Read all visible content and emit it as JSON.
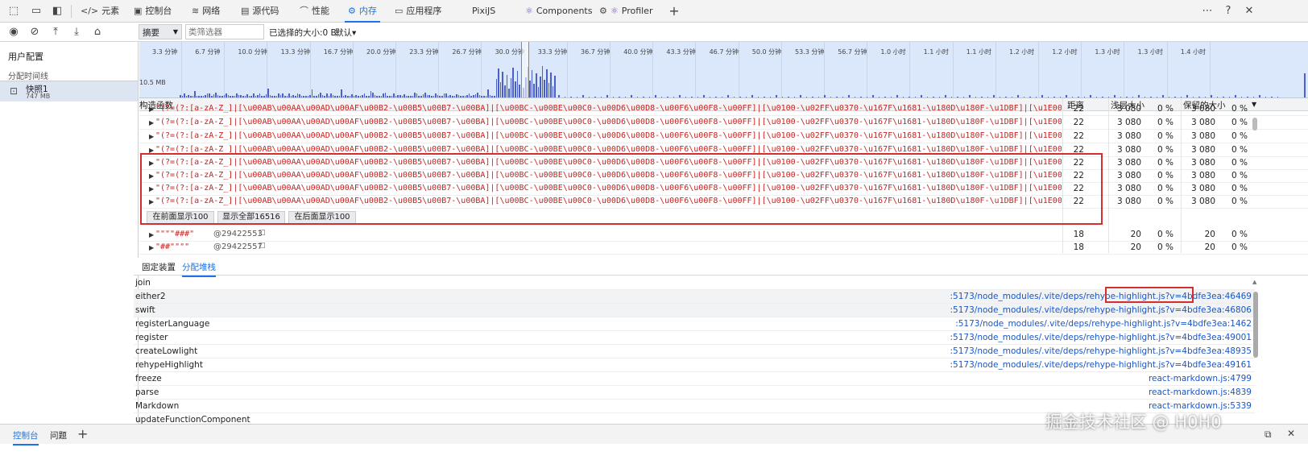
{
  "tabs": [
    {
      "label": "元素",
      "icon": "code-icon"
    },
    {
      "label": "控制台",
      "icon": "console-icon"
    },
    {
      "label": "网络",
      "icon": "wifi-icon"
    },
    {
      "label": "源代码",
      "icon": "sources-icon"
    },
    {
      "label": "性能",
      "icon": "performance-icon"
    },
    {
      "label": "内存",
      "icon": "memory-icon"
    },
    {
      "label": "应用程序",
      "icon": "application-icon"
    },
    {
      "label": "PixiJS",
      "icon": ""
    },
    {
      "label": "Components",
      "icon": "react-icon"
    },
    {
      "label": "Profiler",
      "icon": "react-icon"
    }
  ],
  "toolbar": {
    "view_select": "摘要",
    "class_filter_placeholder": "类筛选器",
    "selected_size": "已选择的大小:0 B",
    "default_dropdown": "默认▾"
  },
  "sidebar": {
    "profiles_title": "用户配置",
    "timeline_label": "分配时间线",
    "snapshot_name": "快照1",
    "snapshot_size": "747 MB"
  },
  "overview": {
    "ticks": [
      "3.3 分钟",
      "6.7 分钟",
      "10.0 分钟",
      "13.3 分钟",
      "16.7 分钟",
      "20.0 分钟",
      "23.3 分钟",
      "26.7 分钟",
      "30.0 分钟",
      "33.3 分钟",
      "36.7 分钟",
      "40.0 分钟",
      "43.3 分钟",
      "46.7 分钟",
      "50.0 分钟",
      "53.3 分钟",
      "56.7 分钟",
      "1.0 小时",
      "1.1 小时",
      "1.1 小时",
      "1.2 小时",
      "1.2 小时",
      "1.3 小时",
      "1.3 小时",
      "1.4 小时"
    ],
    "size_label": "10.5 MB"
  },
  "table": {
    "headers": {
      "constructor": "构造函数",
      "distance": "距离",
      "shallow": "浅层大小",
      "retained": "保留的大小"
    },
    "regex_text": "\"(?=(?:[a-zA-Z_]|[\\u00AB\\u00AA\\u00AD\\u00AF\\u00B2-\\u00B5\\u00B7-\\u00BA]|[\\u00BC-\\u00BE\\u00C0-\\u00D6\\u00D8-\\u00F6\\u00F8-\\u00FF]|[\\u0100-\\u02FF\\u0370-\\u167F\\u1681-\\u180D\\u180F-\\u1DBF]|[\\u1E00-\\u1FFF]|[\\u200B-\\u200",
    "regex_rows": [
      {
        "distance": "22",
        "shallow": "3 080",
        "shallow_pct": "0 %",
        "retained": "3 080",
        "retained_pct": "0 %"
      },
      {
        "distance": "22",
        "shallow": "3 080",
        "shallow_pct": "0 %",
        "retained": "3 080",
        "retained_pct": "0 %"
      },
      {
        "distance": "22",
        "shallow": "3 080",
        "shallow_pct": "0 %",
        "retained": "3 080",
        "retained_pct": "0 %"
      },
      {
        "distance": "22",
        "shallow": "3 080",
        "shallow_pct": "0 %",
        "retained": "3 080",
        "retained_pct": "0 %"
      },
      {
        "distance": "22",
        "shallow": "3 080",
        "shallow_pct": "0 %",
        "retained": "3 080",
        "retained_pct": "0 %"
      },
      {
        "distance": "22",
        "shallow": "3 080",
        "shallow_pct": "0 %",
        "retained": "3 080",
        "retained_pct": "0 %"
      },
      {
        "distance": "22",
        "shallow": "3 080",
        "shallow_pct": "0 %",
        "retained": "3 080",
        "retained_pct": "0 %"
      },
      {
        "distance": "22",
        "shallow": "3 080",
        "shallow_pct": "0 %",
        "retained": "3 080",
        "retained_pct": "0 %"
      }
    ],
    "paging": {
      "prev": "在前面显示100",
      "all": "显示全部16516",
      "next": "在后面显示100"
    },
    "tail_rows": [
      {
        "name": "\"\"\"\"###\"",
        "id": "@29422553",
        "distance": "18",
        "shallow": "20",
        "shallow_pct": "0 %",
        "retained": "20",
        "retained_pct": "0 %"
      },
      {
        "name": "\"##\"\"\"\"",
        "id": "@29422557",
        "distance": "18",
        "shallow": "20",
        "shallow_pct": "0 %",
        "retained": "20",
        "retained_pct": "0 %"
      }
    ]
  },
  "bottom": {
    "tabs": [
      "固定装置",
      "分配堆栈"
    ],
    "stack": [
      {
        "fn": "join",
        "loc": ""
      },
      {
        "fn": "either2",
        "loc": ":5173/node_modules/.vite/deps/rehype-highlight.js?v=4bdfe3ea:46469"
      },
      {
        "fn": "swift",
        "loc": ":5173/node_modules/.vite/deps/rehype-highlight.js?v=4bdfe3ea:46806"
      },
      {
        "fn": "registerLanguage",
        "loc": ":5173/node_modules/.vite/deps/rehype-highlight.js?v=4bdfe3ea:1462"
      },
      {
        "fn": "register",
        "loc": ":5173/node_modules/.vite/deps/rehype-highlight.js?v=4bdfe3ea:49001"
      },
      {
        "fn": "createLowlight",
        "loc": ":5173/node_modules/.vite/deps/rehype-highlight.js?v=4bdfe3ea:48935"
      },
      {
        "fn": "rehypeHighlight",
        "loc": ":5173/node_modules/.vite/deps/rehype-highlight.js?v=4bdfe3ea:49161"
      },
      {
        "fn": "freeze",
        "loc": "react-markdown.js:4799"
      },
      {
        "fn": "parse",
        "loc": "react-markdown.js:4839"
      },
      {
        "fn": "Markdown",
        "loc": "react-markdown.js:5339"
      },
      {
        "fn": "updateFunctionComponent",
        "loc": ""
      }
    ]
  },
  "drawer": {
    "tabs": [
      "控制台",
      "问题"
    ]
  },
  "watermark": "掘金技术社区 @ H0H0"
}
